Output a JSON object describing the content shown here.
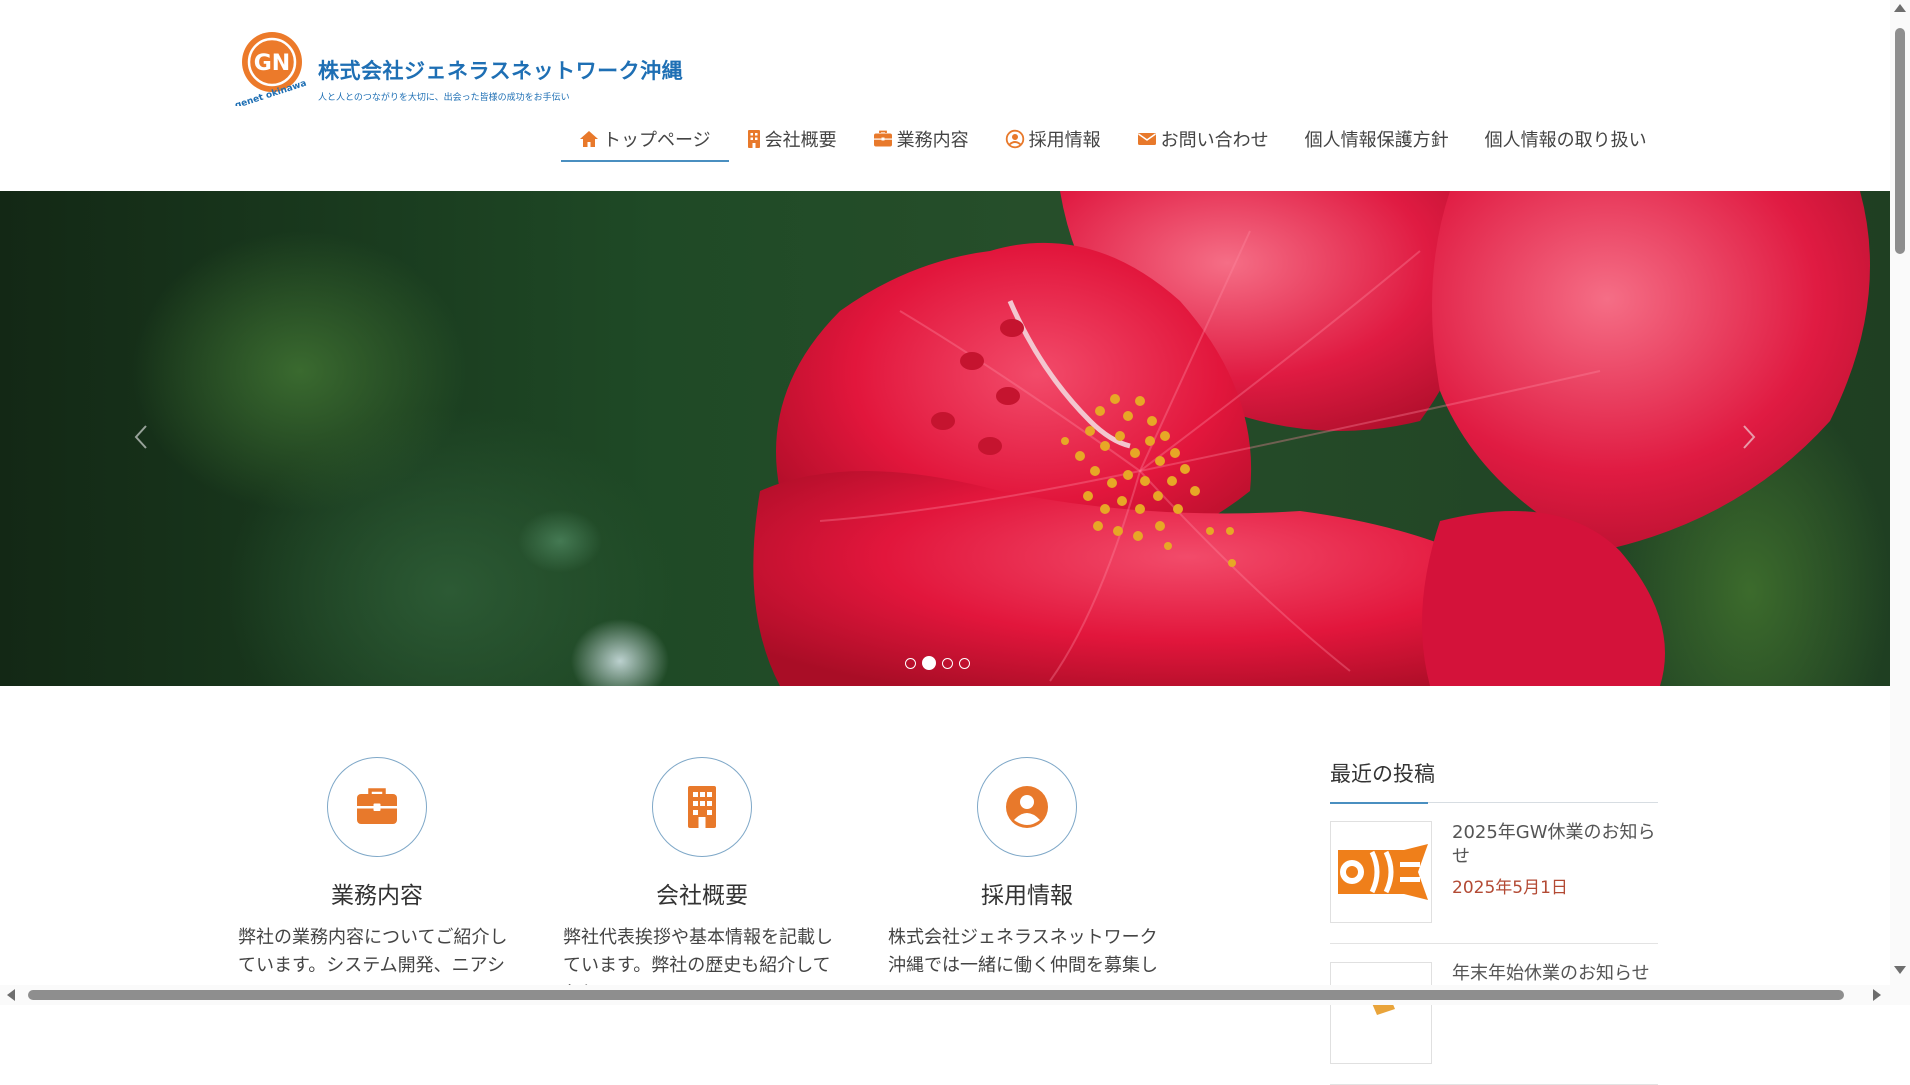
{
  "brand": {
    "logo_text": "GN",
    "logo_sub": "genet okinawa",
    "company_name": "株式会社ジェネラスネットワーク沖縄",
    "tagline": "人と人とのつながりを大切に、出会った皆様の成功をお手伝い"
  },
  "nav": {
    "items": [
      {
        "label": "トップページ",
        "icon": "home-icon"
      },
      {
        "label": "会社概要",
        "icon": "building-icon"
      },
      {
        "label": "業務内容",
        "icon": "briefcase-icon"
      },
      {
        "label": "採用情報",
        "icon": "user-circle-icon"
      },
      {
        "label": "お問い合わせ",
        "icon": "envelope-icon"
      },
      {
        "label": "個人情報保護方針",
        "icon": ""
      },
      {
        "label": "個人情報の取り扱い",
        "icon": ""
      }
    ],
    "active_index": 0
  },
  "hero": {
    "slide_count": 4,
    "active_slide": 1
  },
  "features": [
    {
      "title": "業務内容",
      "icon": "briefcase-icon",
      "text": "弊社の業務内容についてご紹介しています。システム開発、ニアショア"
    },
    {
      "title": "会社概要",
      "icon": "building-icon",
      "text": "弊社代表挨拶や基本情報を記載しています。弊社の歴史も紹介しており"
    },
    {
      "title": "採用情報",
      "icon": "user-circle-icon",
      "text": "株式会社ジェネラスネットワーク沖縄では一緒に働く仲間を募集してい"
    }
  ],
  "sidebar": {
    "heading": "最近の投稿",
    "posts": [
      {
        "title": "2025年GW休業のお知らせ",
        "date": "2025年5月1日"
      },
      {
        "title": "年末年始休業のお知らせ",
        "date": ""
      }
    ]
  },
  "colors": {
    "accent_orange": "#e8792b",
    "brand_blue": "#1e6fb4",
    "date_red": "#b34a34"
  }
}
